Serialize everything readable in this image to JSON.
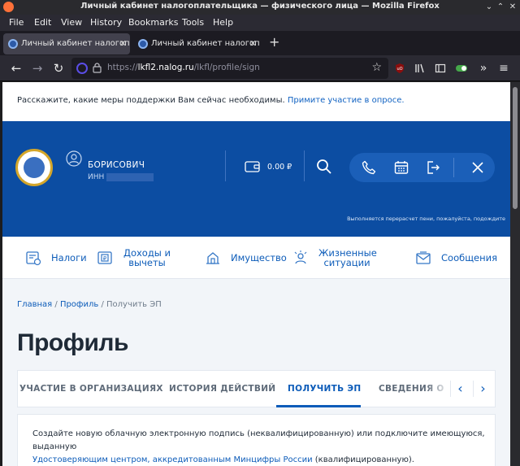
{
  "window": {
    "title": "Личный кабинет налогоплательщика — физического лица — Mozilla Firefox"
  },
  "menu": [
    "File",
    "Edit",
    "View",
    "History",
    "Bookmarks",
    "Tools",
    "Help"
  ],
  "tabs": [
    {
      "label": "Личный кабинет налогоп",
      "active": true
    },
    {
      "label": "Личный кабинет налогоп",
      "active": false
    }
  ],
  "url": {
    "prefix": "https://",
    "domain": "lkfl2.nalog.ru",
    "path": "/lkfl/profile/sign"
  },
  "survey": {
    "text": "Расскажите, какие меры поддержки Вам сейчас необходимы. ",
    "link": "Примите участие в опросе."
  },
  "header": {
    "user_name": "БОРИСОВИЧ",
    "inn_label": "ИНН",
    "balance": "0.00 ₽",
    "notice": "Выполняется перерасчет пени, пожалуйста, подождите"
  },
  "nav": [
    {
      "label": "Налоги",
      "icon": "tax-icon"
    },
    {
      "label": "Доходы и вычеты",
      "icon": "income-icon"
    },
    {
      "label": "Имущество",
      "icon": "property-icon"
    },
    {
      "label": "Жизненные ситуации",
      "icon": "life-situations-icon"
    },
    {
      "label": "Сообщения",
      "icon": "messages-icon"
    }
  ],
  "breadcrumb": {
    "home": "Главная",
    "profile": "Профиль",
    "current": "Получить ЭП",
    "sep": " / "
  },
  "page_title": "Профиль",
  "profile_tabs": [
    {
      "label": "УЧАСТИЕ В ОРГАНИЗАЦИЯХ",
      "active": false
    },
    {
      "label": "ИСТОРИЯ ДЕЙСТВИЙ",
      "active": false
    },
    {
      "label": "ПОЛУЧИТЬ ЭП",
      "active": true
    },
    {
      "label": "СВЕДЕНИЯ О ",
      "active": false
    }
  ],
  "card": {
    "text": "Создайте новую облачную электронную подпись (неквалифицированную) или подключите имеющуюся, выданную",
    "link": "Удостоверяющим центром, аккредитованным Минцифры России",
    "tail": " (квалифицированную)."
  },
  "colors": {
    "brand_blue": "#0c4da2",
    "link_blue": "#0d5cb9",
    "tab_active": "#42414d"
  }
}
